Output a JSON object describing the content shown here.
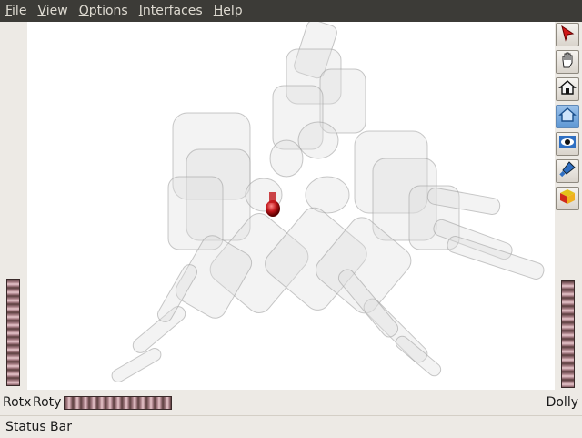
{
  "menubar": {
    "items": [
      {
        "label": "File"
      },
      {
        "label": "View"
      },
      {
        "label": "Options"
      },
      {
        "label": "Interfaces"
      },
      {
        "label": "Help"
      }
    ]
  },
  "toolbar": {
    "tools": [
      {
        "icon": "select-arrow-icon",
        "active": false
      },
      {
        "icon": "hand-view-icon",
        "active": false
      },
      {
        "icon": "home-icon",
        "active": false
      },
      {
        "icon": "set-home-icon",
        "active": true
      },
      {
        "icon": "view-all-eye-icon",
        "active": false
      },
      {
        "icon": "seek-flashlight-icon",
        "active": false
      },
      {
        "icon": "projection-cube-icon",
        "active": false
      }
    ]
  },
  "bottom": {
    "rotx": "Rotx",
    "roty": "Roty",
    "dolly": "Dolly"
  },
  "status": {
    "text": "Status Bar"
  },
  "colors": {
    "menubar_bg": "#3c3b37",
    "menubar_text": "#dfdbd2",
    "viewport_bg": "#ffffff",
    "wheel_color": "#a87f86",
    "highlight_sphere": "#c0161b"
  }
}
